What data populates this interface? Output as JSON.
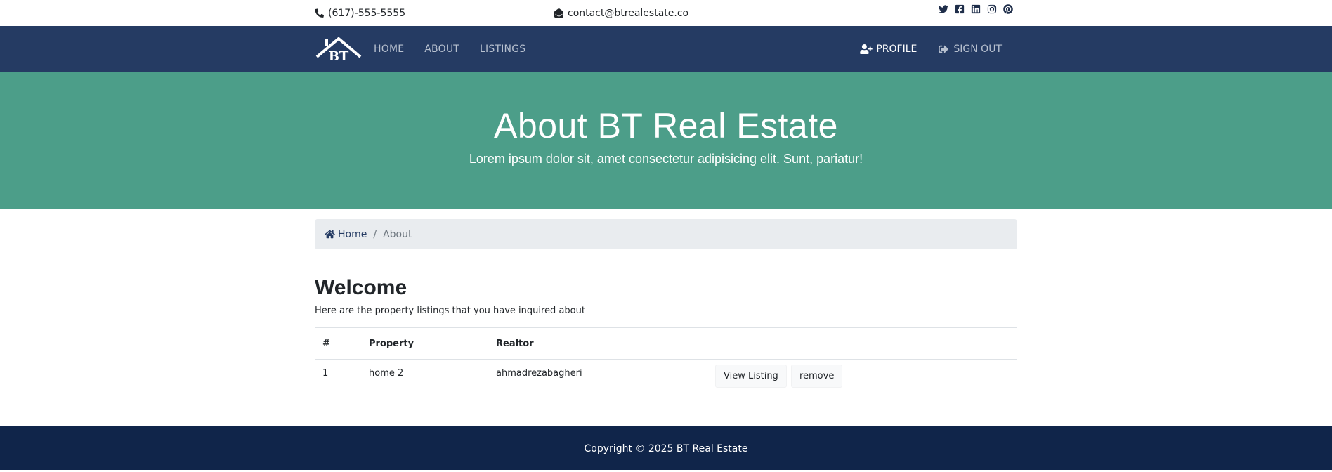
{
  "topbar": {
    "phone": "(617)-555-5555",
    "email": "contact@btrealestate.co",
    "social": [
      "twitter-icon",
      "facebook-icon",
      "linkedin-icon",
      "instagram-icon",
      "pinterest-icon"
    ]
  },
  "navbar": {
    "logo_text": "BT",
    "links": [
      "HOME",
      "ABOUT",
      "LISTINGS"
    ],
    "profile_label": "PROFILE",
    "signout_label": "SIGN OUT"
  },
  "hero": {
    "title": "About BT Real Estate",
    "subtitle": "Lorem ipsum dolor sit, amet consectetur adipisicing elit. Sunt, pariatur!"
  },
  "breadcrumb": {
    "home": "Home",
    "separator": "/",
    "current": "About"
  },
  "main": {
    "heading": "Welcome",
    "intro": "Here are the property listings that you have inquired about",
    "table": {
      "headers": [
        "#",
        "Property",
        "Realtor"
      ],
      "rows": [
        {
          "num": "1",
          "property": "home 2",
          "realtor": "ahmadrezabagheri",
          "view_label": "View Listing",
          "remove_label": "remove"
        }
      ]
    }
  },
  "footer": {
    "copyright": "Copyright © 2025 BT Real Estate"
  },
  "colors": {
    "navbar": "#253b63",
    "hero": "#4c9e89",
    "footer": "#10254a",
    "breadcrumb_bg": "#e9ecef"
  }
}
